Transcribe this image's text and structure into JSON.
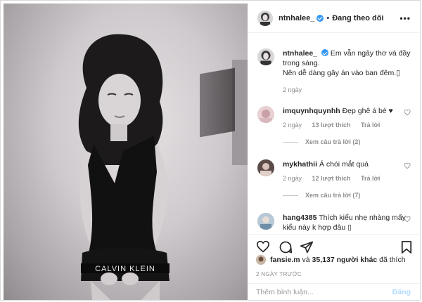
{
  "post": {
    "author": "ntnhalee_",
    "follow_status": "Đang theo dõi",
    "separator": "•",
    "more": "•••",
    "caption": {
      "username": "ntnhalee_",
      "text": "Em vẫn ngây thơ và đầy trong sáng.",
      "text2": "Nên dễ dàng gây án vào ban đêm.▯",
      "time": "2 ngày"
    },
    "comments": [
      {
        "username": "imquynhquynhh",
        "text": "Đẹp ghê á bé ♥",
        "time": "2 ngày",
        "likes": "13 lượt thích",
        "reply": "Trả lời",
        "view_replies": "Xem câu trả lời (2)"
      },
      {
        "username": "mykhathii",
        "text": "Á chói mắt quá",
        "time": "2 ngày",
        "likes": "12 lượt thích",
        "reply": "Trả lời",
        "view_replies": "Xem câu trả lời (7)"
      },
      {
        "username": "hang4385",
        "text": "Thích kiểu nhẹ nhàng mấy kiểu này k hợp đâu ▯"
      }
    ],
    "likes": {
      "user": "fansie.m",
      "connector": "và",
      "count": "35,137 người khác",
      "suffix": "đã thích"
    },
    "timestamp": "2 NGÀY TRƯỚC",
    "comment_placeholder": "Thêm bình luận...",
    "post_button": "Đăng",
    "photo_print": "CALVIN KLEIN"
  },
  "colors": {
    "accent": "#3897f0",
    "muted": "#8e8e8e",
    "post_disabled": "#b3dbff"
  },
  "icons": [
    "verified-icon",
    "heart-icon",
    "comment-icon",
    "share-icon",
    "bookmark-icon",
    "more-options-icon"
  ]
}
